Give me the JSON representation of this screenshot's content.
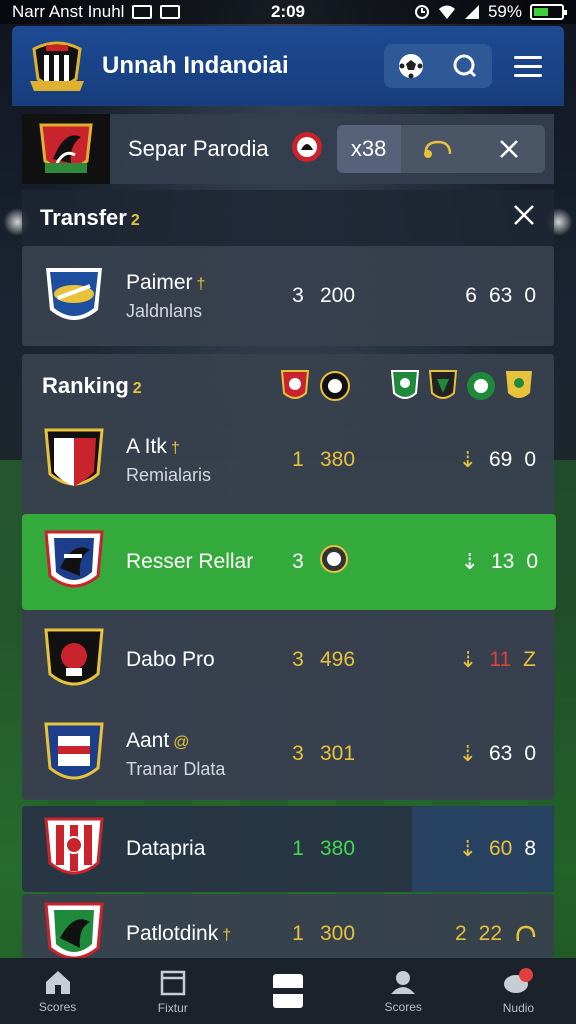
{
  "status_bar": {
    "carrier": "Narr Anst Inuhl",
    "time": "2:09",
    "battery": "59%"
  },
  "header": {
    "title": "Unnah Indanoiai",
    "icons": [
      "soccer-ball-icon",
      "search-icon",
      "menu-icon"
    ]
  },
  "match": {
    "title": "Separ Parodia",
    "score": "x38"
  },
  "transfer": {
    "title": "Transfer",
    "tag": "2",
    "row": {
      "name": "Paimer",
      "tag": "†",
      "sub": "Jaldnlans",
      "stat_a": "3",
      "stat_b": "200",
      "stat_c1": "6",
      "stat_c2": "63",
      "stat_c3": "0"
    }
  },
  "ranking": {
    "title": "Ranking",
    "tag": "2",
    "rows": [
      {
        "name": "A Itk",
        "tag": "†",
        "sub": "Remialaris",
        "stat_a": "1",
        "stat_b": "380",
        "stat_c2": "69",
        "stat_c3": "0"
      },
      {
        "name": "Resser Rellar",
        "tag": "",
        "sub": "",
        "stat_a": "3",
        "stat_b": "",
        "stat_c2": "13",
        "stat_c3": "0"
      },
      {
        "name": "Dabo Pro",
        "tag": "",
        "sub": "",
        "stat_a": "3",
        "stat_b": "496",
        "stat_c2": "11",
        "stat_c3": "Z"
      },
      {
        "name": "Aant",
        "tag": "@",
        "sub": "Tranar Dlata",
        "stat_a": "3",
        "stat_b": "301",
        "stat_c2": "63",
        "stat_c3": "0"
      },
      {
        "name": "Datapria",
        "tag": "",
        "sub": "",
        "stat_a": "1",
        "stat_b": "380",
        "stat_c2": "60",
        "stat_c3": "8"
      },
      {
        "name": "Patlotdink",
        "tag": "†",
        "sub": "",
        "stat_a": "1",
        "stat_b": "300",
        "stat_c1": "2",
        "stat_c2": "22",
        "stat_c3": ""
      }
    ]
  },
  "bottom_nav": [
    {
      "label": "Scores",
      "icon": "home-icon"
    },
    {
      "label": "Fixtur",
      "icon": "calendar-icon"
    },
    {
      "label": "",
      "icon": "center-icon"
    },
    {
      "label": "Scores",
      "icon": "team-icon"
    },
    {
      "label": "Nudio",
      "icon": "chat-icon"
    }
  ]
}
